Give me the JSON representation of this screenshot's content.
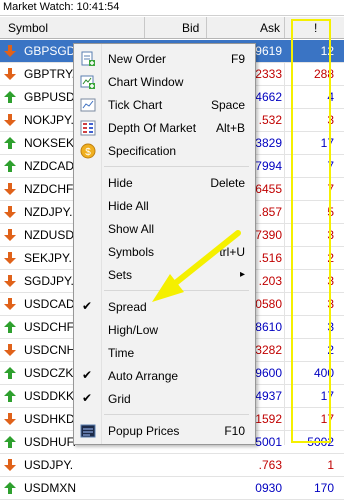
{
  "window": {
    "title": "Market Watch: 10:41:54"
  },
  "columns": {
    "symbol": "Symbol",
    "bid": "Bid",
    "ask": "Ask",
    "spread": "!"
  },
  "rows": [
    {
      "symbol": "GBPSGD.",
      "ask": "9619",
      "spread": "12",
      "dir": "down",
      "spread_color": "#ffffff",
      "selected": true
    },
    {
      "symbol": "GBPTRY.",
      "ask": "2333",
      "spread": "288",
      "dir": "down",
      "spread_color": "#c00000"
    },
    {
      "symbol": "GBPUSD.",
      "ask": "4662",
      "spread": "4",
      "dir": "up",
      "spread_color": "#0000c0"
    },
    {
      "symbol": "NOKJPY.",
      "ask": ".532",
      "spread": "3",
      "dir": "down",
      "spread_color": "#c00000"
    },
    {
      "symbol": "NOKSEK.",
      "ask": "3829",
      "spread": "17",
      "dir": "up",
      "spread_color": "#0000c0"
    },
    {
      "symbol": "NZDCAD",
      "ask": "7994",
      "spread": "7",
      "dir": "up",
      "spread_color": "#0000c0"
    },
    {
      "symbol": "NZDCHF",
      "ask": "6455",
      "spread": "7",
      "dir": "down",
      "spread_color": "#c00000"
    },
    {
      "symbol": "NZDJPY.",
      "ask": ".857",
      "spread": "5",
      "dir": "down",
      "spread_color": "#c00000"
    },
    {
      "symbol": "NZDUSD",
      "ask": "7390",
      "spread": "3",
      "dir": "down",
      "spread_color": "#c00000"
    },
    {
      "symbol": "SEKJPY.",
      "ask": ".516",
      "spread": "2",
      "dir": "down",
      "spread_color": "#c00000"
    },
    {
      "symbol": "SGDJPY.",
      "ask": ".203",
      "spread": "3",
      "dir": "down",
      "spread_color": "#c00000"
    },
    {
      "symbol": "USDCAD",
      "ask": "0580",
      "spread": "3",
      "dir": "down",
      "spread_color": "#c00000"
    },
    {
      "symbol": "USDCHF.",
      "ask": "8610",
      "spread": "3",
      "dir": "up",
      "spread_color": "#0000c0"
    },
    {
      "symbol": "USDCNH",
      "ask": "3282",
      "spread": "2",
      "dir": "down",
      "spread_color": "#0000c0"
    },
    {
      "symbol": "USDCZK.",
      "ask": "9600",
      "spread": "400",
      "dir": "up",
      "spread_color": "#0000c0"
    },
    {
      "symbol": "USDDKK.",
      "ask": "4937",
      "spread": "17",
      "dir": "up",
      "spread_color": "#0000c0"
    },
    {
      "symbol": "USDHKD",
      "ask": "1592",
      "spread": "17",
      "dir": "down",
      "spread_color": "#c00000"
    },
    {
      "symbol": "USDHUF.",
      "ask": "5001",
      "spread": "5002",
      "dir": "up",
      "spread_color": "#0000c0"
    },
    {
      "symbol": "USDJPY.",
      "ask": ".763",
      "spread": "1",
      "dir": "down",
      "spread_color": "#c00000"
    },
    {
      "symbol": "USDMXN",
      "ask": "0930",
      "spread": "170",
      "dir": "up",
      "spread_color": "#0000c0"
    }
  ],
  "menu": {
    "new_order": {
      "label": "New Order",
      "shortcut": "F9",
      "icon": "new-order-icon"
    },
    "chart_window": {
      "label": "Chart Window",
      "icon": "chart-window-icon"
    },
    "tick_chart": {
      "label": "Tick Chart",
      "shortcut": "Space",
      "icon": "tick-chart-icon"
    },
    "depth_of_market": {
      "label": "Depth Of Market",
      "shortcut": "Alt+B",
      "icon": "depth-of-market-icon"
    },
    "specification": {
      "label": "Specification",
      "icon": "specification-icon"
    },
    "hide": {
      "label": "Hide",
      "shortcut": "Delete"
    },
    "hide_all": {
      "label": "Hide All"
    },
    "show_all": {
      "label": "Show All"
    },
    "symbols": {
      "label": "Symbols",
      "shortcut": "trl+U"
    },
    "sets": {
      "label": "Sets",
      "submenu_arrow": "▸"
    },
    "spread": {
      "label": "Spread",
      "checked": "✔"
    },
    "high_low": {
      "label": "High/Low"
    },
    "time": {
      "label": "Time"
    },
    "auto_arrange": {
      "label": "Auto Arrange",
      "checked": "✔"
    },
    "grid": {
      "label": "Grid",
      "checked": "✔"
    },
    "popup_prices": {
      "label": "Popup Prices",
      "shortcut": "F10",
      "icon": "popup-prices-icon"
    }
  },
  "colors": {
    "selection": "#3a74c4",
    "annotation": "#f5f000",
    "up_arrow": "#2ea02e",
    "down_arrow": "#e0621a"
  }
}
